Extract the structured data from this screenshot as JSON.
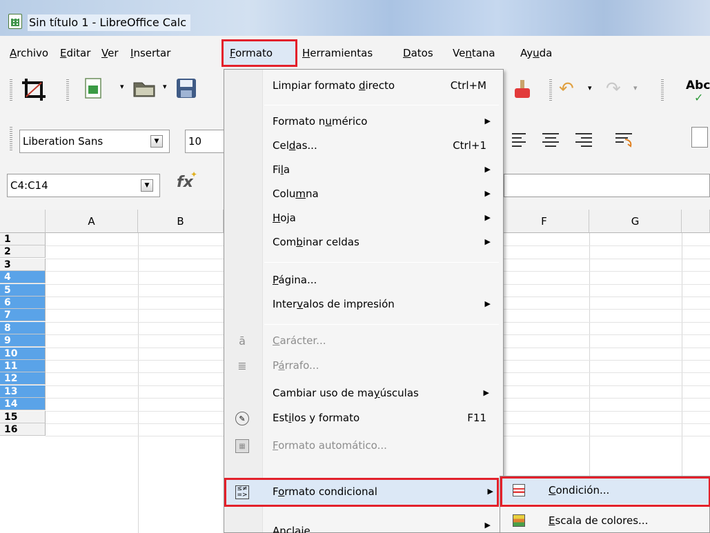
{
  "window": {
    "title": "Sin título 1 - LibreOffice Calc"
  },
  "menubar": [
    {
      "label": "Archivo",
      "u": "A"
    },
    {
      "label": "Editar",
      "u": "E"
    },
    {
      "label": "Ver",
      "u": "V"
    },
    {
      "label": "Insertar",
      "u": "I"
    },
    {
      "label": "Formato",
      "u": "F"
    },
    {
      "label": "Herramientas",
      "u": "H"
    },
    {
      "label": "Datos",
      "u": "D"
    },
    {
      "label": "Ventana",
      "u": "n"
    },
    {
      "label": "Ayuda",
      "u": "u"
    }
  ],
  "toolbar": {
    "font_name": "Liberation Sans",
    "font_size": "10",
    "spell_label": "Abc"
  },
  "namebox": {
    "value": "C4:C14"
  },
  "columns": [
    "A",
    "B",
    "F",
    "G"
  ],
  "rows": [
    "1",
    "2",
    "3",
    "4",
    "5",
    "6",
    "7",
    "8",
    "9",
    "10",
    "11",
    "12",
    "13",
    "14",
    "15",
    "16"
  ],
  "selected_rows": [
    "4",
    "5",
    "6",
    "7",
    "8",
    "9",
    "10",
    "11",
    "12",
    "13",
    "14"
  ],
  "format_menu": {
    "limpiar": {
      "pre": "Limpiar formato ",
      "u": "d",
      "post": "irecto",
      "shortcut": "Ctrl+M"
    },
    "numerico": {
      "pre": "Formato n",
      "u": "u",
      "post": "mérico"
    },
    "celdas": {
      "pre": "Cel",
      "u": "d",
      "post": "as...",
      "shortcut": "Ctrl+1"
    },
    "fila": {
      "pre": "Fi",
      "u": "l",
      "post": "a"
    },
    "columna": {
      "pre": "Colu",
      "u": "m",
      "post": "na"
    },
    "hoja": {
      "pre": "",
      "u": "H",
      "post": "oja"
    },
    "combinar": {
      "pre": "Com",
      "u": "b",
      "post": "inar celdas"
    },
    "pagina": {
      "pre": "",
      "u": "P",
      "post": "ágina..."
    },
    "intervalos": {
      "pre": "Inter",
      "u": "v",
      "post": "alos de impresión"
    },
    "caracter": {
      "pre": "",
      "u": "C",
      "post": "arácter..."
    },
    "parrafo": {
      "pre": "P",
      "u": "á",
      "post": "rrafo..."
    },
    "mayusculas": {
      "pre": "Cambiar uso de ma",
      "u": "y",
      "post": "úsculas"
    },
    "estilos": {
      "pre": "Est",
      "u": "i",
      "post": "los y formato",
      "shortcut": "F11"
    },
    "automatico": {
      "pre": "",
      "u": "F",
      "post": "ormato automático..."
    },
    "condicional": {
      "pre": "F",
      "u": "o",
      "post": "rmato condicional"
    },
    "anclaje": {
      "label": "Anclaje"
    }
  },
  "submenu": {
    "condicion": {
      "pre": "",
      "u": "C",
      "post": "ondición..."
    },
    "escala": {
      "pre": "",
      "u": "E",
      "post": "scala de colores..."
    }
  }
}
